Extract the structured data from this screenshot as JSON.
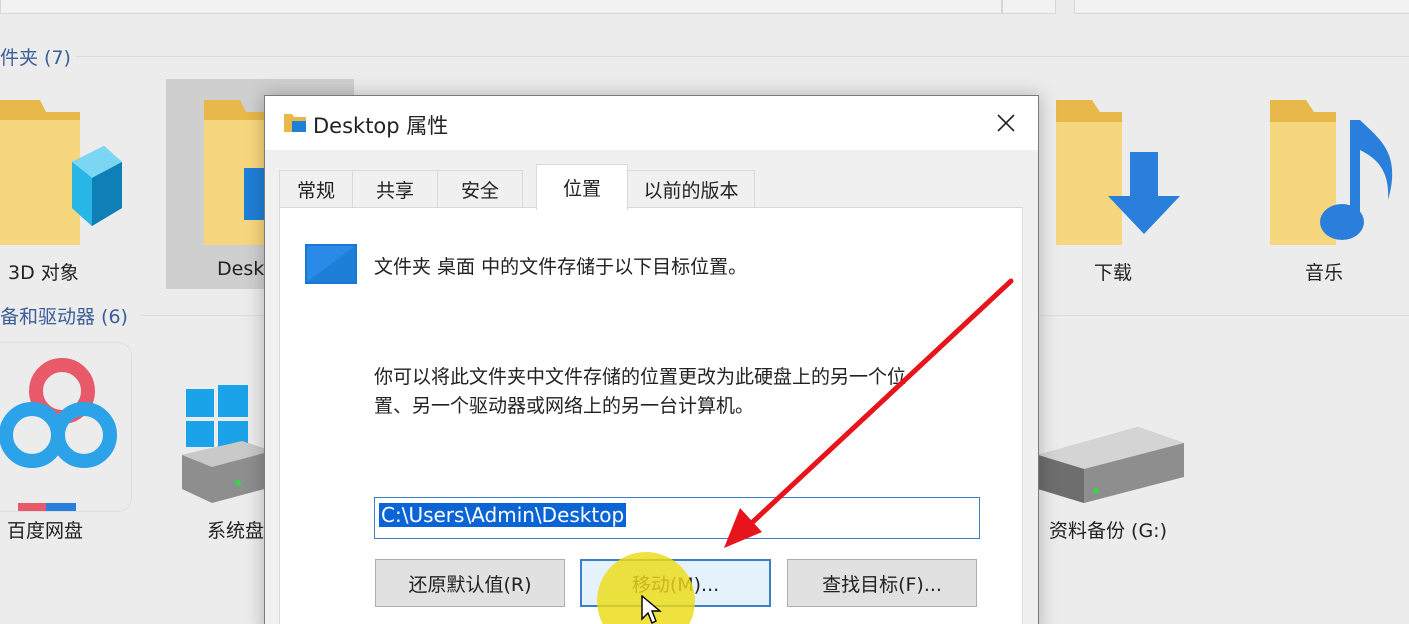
{
  "explorer": {
    "folders_header": "件夹 (7)",
    "drives_header": "备和驱动器 (6)",
    "folders": [
      {
        "label": "3D 对象"
      },
      {
        "label": "Desk"
      },
      {
        "label": "下载"
      },
      {
        "label": "音乐"
      }
    ],
    "drives": [
      {
        "label": "百度网盘"
      },
      {
        "label": "系统盘"
      },
      {
        "label": "资料备份 (G:)"
      }
    ]
  },
  "dialog": {
    "title": "Desktop 属性",
    "close_symbol": "✕",
    "tabs": [
      {
        "label": "常规"
      },
      {
        "label": "共享"
      },
      {
        "label": "安全"
      },
      {
        "label": "位置"
      },
      {
        "label": "以前的版本"
      }
    ],
    "active_tab": "位置",
    "info_text": "文件夹 桌面 中的文件存储于以下目标位置。",
    "desc_line1": "你可以将此文件夹中文件存储的位置更改为此硬盘上的另一个位",
    "desc_line2": "置、另一个驱动器或网络上的另一台计算机。",
    "path_value": "C:\\Users\\Admin\\Desktop",
    "buttons": {
      "restore": "还原默认值(R)",
      "move": "移动(M)...",
      "find": "查找目标(F)..."
    }
  },
  "colors": {
    "accent": "#0a64d6",
    "annotation_arrow": "#e8141c",
    "cursor_highlight": "#ecdc14"
  }
}
